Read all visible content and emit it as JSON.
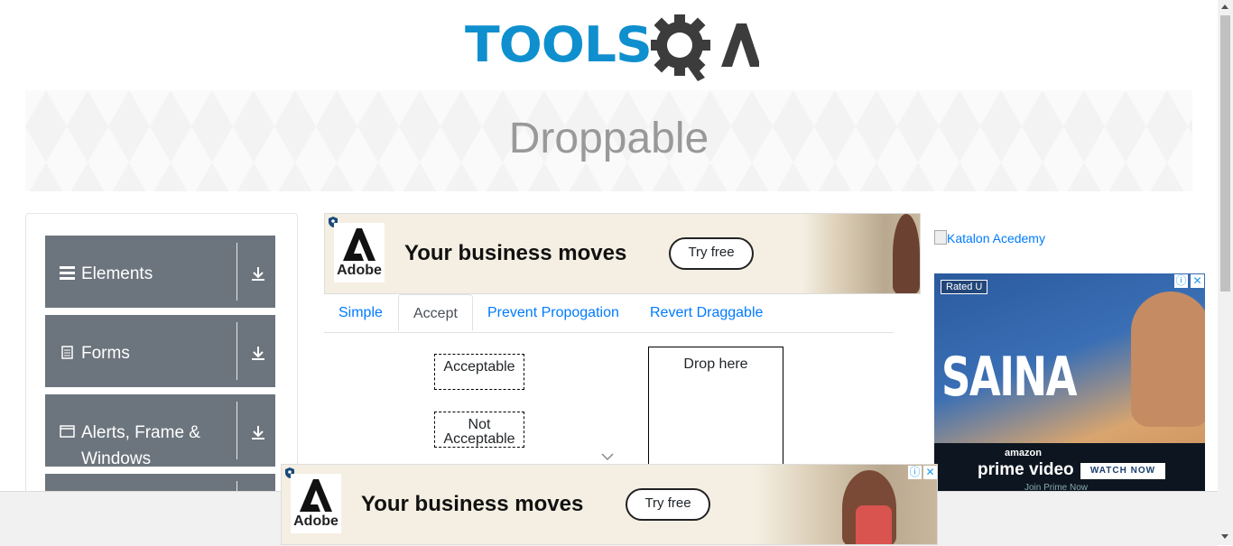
{
  "header": {
    "logo_text": "TOOLS",
    "logo_suffix": "A"
  },
  "banner": {
    "title": "Droppable"
  },
  "sidebar": {
    "groups": [
      {
        "label": "Elements",
        "icon": "hamburger-icon"
      },
      {
        "label": "Forms",
        "icon": "document-icon"
      },
      {
        "label": "Alerts, Frame & Windows",
        "icon": "window-icon"
      }
    ]
  },
  "ads": {
    "top": {
      "brand": "Adobe",
      "headline": "Your business moves",
      "cta": "Try free"
    },
    "bottom": {
      "brand": "Adobe",
      "headline": "Your business moves",
      "cta": "Try free"
    },
    "right_image_alt": "Katalon Acedemy",
    "right_video": {
      "rating": "Rated U",
      "title": "SAINA",
      "amazon": "amazon",
      "service": "prime video",
      "cta": "WATCH NOW",
      "footer": "Join Prime Now"
    }
  },
  "tabs": [
    {
      "label": "Simple",
      "active": false
    },
    {
      "label": "Accept",
      "active": true
    },
    {
      "label": "Prevent Propogation",
      "active": false
    },
    {
      "label": "Revert Draggable",
      "active": false
    }
  ],
  "accept_tab": {
    "draggables": [
      "Acceptable",
      "Not Acceptable"
    ],
    "drop_target": "Drop here"
  },
  "colors": {
    "logo_blue": "#0f8fce",
    "logo_gray": "#3c3c3c",
    "sidebar_group": "#6c757d",
    "link": "#007bff"
  }
}
